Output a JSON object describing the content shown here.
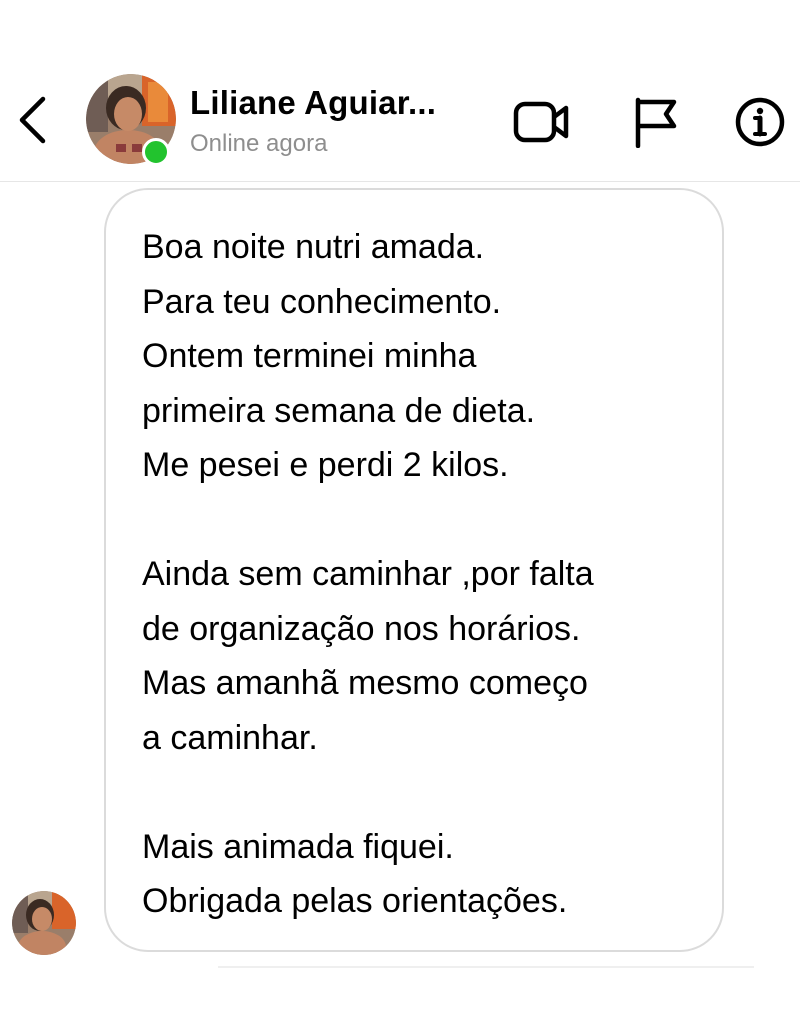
{
  "header": {
    "contact_name": "Liliane Aguiar...",
    "status": "Online agora",
    "icons": {
      "back": "chevron-left-icon",
      "video": "video-camera-icon",
      "flag": "flag-icon",
      "info": "info-icon"
    }
  },
  "message": {
    "lines": [
      "Boa noite nutri amada.",
      "Para teu conhecimento.",
      "Ontem terminei minha",
      "primeira semana de dieta.",
      "Me pesei e perdi 2 kilos.",
      "",
      "Ainda sem caminhar ,por falta",
      "de organização nos horários.",
      "Mas amanhã mesmo começo",
      "a caminhar.",
      "",
      "Mais animada fiquei.",
      "Obrigada pelas orientações."
    ]
  },
  "colors": {
    "online": "#22c32e",
    "status_text": "#8e8e8e",
    "bubble_border": "#dbdbdb",
    "divider": "#e6e6e6"
  }
}
